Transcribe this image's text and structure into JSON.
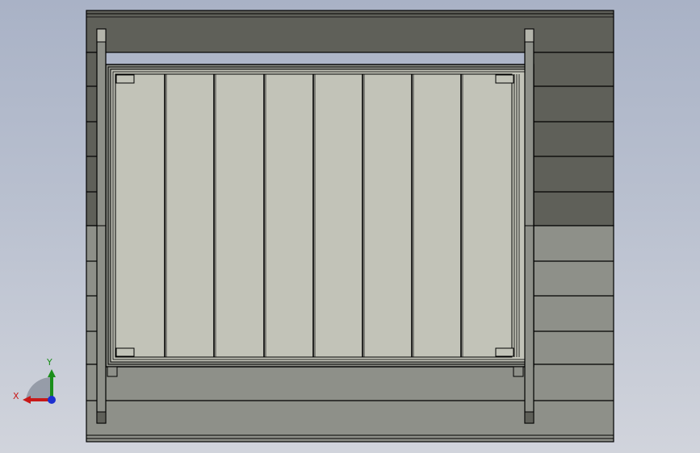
{
  "scene": {
    "background_top": "#a9b2c6",
    "background_bottom": "#d1d4dc",
    "wall_dark_color": "#5f6059",
    "wall_light_color": "#8e9089",
    "panel_face_color": "#c2c3b8",
    "panel_slat_count": 8,
    "wall_band_count": 12,
    "edge_color": "#000000"
  },
  "triad": {
    "x_label": "X",
    "y_label": "Y",
    "x_color": "#c81818",
    "y_color": "#1a8e1a",
    "z_color": "#1c2fd0"
  }
}
